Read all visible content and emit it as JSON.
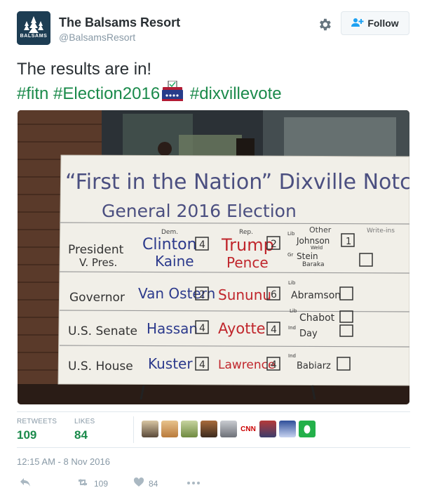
{
  "account": {
    "name": "The Balsams Resort",
    "handle": "@BalsamsResort",
    "avatar_text": "BALSAMS",
    "follow_label": "Follow"
  },
  "tweet": {
    "line1": "The results are in!",
    "hashtags": [
      "#fitn",
      "#Election2016",
      "#dixvillevote"
    ]
  },
  "board": {
    "title_line1": "“First in the Nation” Dixville Notch, NH",
    "title_line2": "General 2016 Election",
    "col_headers": {
      "dem": "Dem.",
      "rep": "Rep.",
      "other": "Other",
      "writein": "Write-ins"
    },
    "rows": [
      {
        "office": "President",
        "office2": "V. Pres.",
        "dem": "Clinton",
        "dem2": "Kaine",
        "dem_votes": "4",
        "rep": "Trump",
        "rep2": "Pence",
        "rep_votes": "2",
        "other_party": "Lib",
        "other": "Johnson",
        "other_sub": "Weld",
        "other_party2": "Gr",
        "other2": "Stein",
        "other2_sub": "Baraka",
        "other_votes": "1"
      },
      {
        "office": "Governor",
        "dem": "Van Ostern",
        "dem_votes": "2",
        "rep": "Sununu",
        "rep_votes": "6",
        "other_party": "Lib",
        "other": "Abramson"
      },
      {
        "office": "U.S. Senate",
        "dem": "Hassan",
        "dem_votes": "4",
        "rep": "Ayotte",
        "rep_votes": "4",
        "other_party": "Lib",
        "other": "Chabot",
        "other_party2": "Ind",
        "other2": "Day"
      },
      {
        "office": "U.S. House",
        "dem": "Kuster",
        "dem_votes": "4",
        "rep": "Lawrence",
        "rep_votes": "4",
        "other_party": "Ind",
        "other": "Babiarz"
      }
    ]
  },
  "stats": {
    "retweets_label": "RETWEETS",
    "retweets": "109",
    "likes_label": "LIKES",
    "likes": "84",
    "liker_icons": [
      "avatar-1",
      "avatar-2",
      "avatar-3",
      "avatar-4",
      "avatar-5",
      "cnn-logo",
      "avatar-7",
      "avatar-8",
      "avatar-9"
    ]
  },
  "timestamp": "12:15 AM - 8 Nov 2016",
  "actions": {
    "retweets": "109",
    "likes": "84"
  },
  "colors": {
    "hashtag": "#1b8a4b",
    "muted": "#8899a6",
    "dem": "#2c3a8c",
    "rep": "#c0262c",
    "cnn": "#cc0000"
  }
}
